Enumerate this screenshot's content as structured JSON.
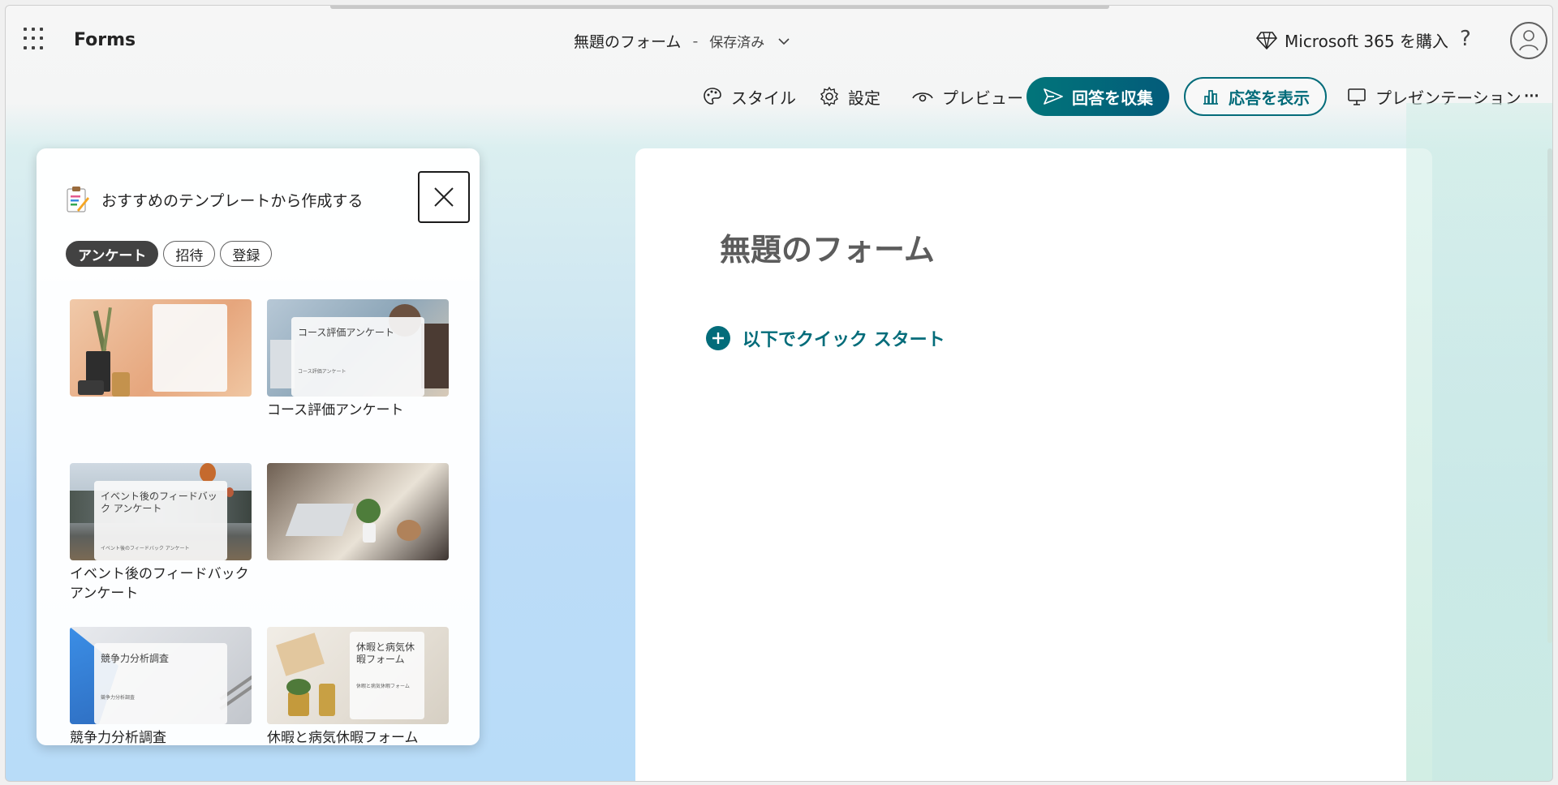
{
  "header": {
    "app_name": "Forms",
    "form_title": "無題のフォーム",
    "separator": "-",
    "save_status": "保存済み",
    "buy_label": "Microsoft 365 を購入",
    "help_label": "?"
  },
  "toolbar": {
    "style_label": "スタイル",
    "settings_label": "設定",
    "preview_label": "プレビュー",
    "collect_label": "回答を収集",
    "responses_label": "応答を表示",
    "present_label": "プレゼンテーション",
    "more_label": "···"
  },
  "templates": {
    "title": "おすすめのテンプレートから作成する",
    "chips": [
      "アンケート",
      "招待",
      "登録"
    ],
    "cards": [
      {
        "label": "",
        "thumb_title": "",
        "thumb_sub": ""
      },
      {
        "label": "コース評価アンケート",
        "thumb_title": "コース評価アンケート",
        "thumb_sub": "コース評価アンケート"
      },
      {
        "label": "イベント後のフィードバック アンケート",
        "thumb_title": "イベント後のフィードバック アンケート",
        "thumb_sub": "イベント後のフィードバック アンケート"
      },
      {
        "label": "",
        "thumb_title": "",
        "thumb_sub": ""
      },
      {
        "label": "競争力分析調査",
        "thumb_title": "競争力分析調査",
        "thumb_sub": "競争力分析調査"
      },
      {
        "label": "休暇と病気休暇フォーム",
        "thumb_title": "休暇と病気休暇フォーム",
        "thumb_sub": "休暇と病気休暇フォーム"
      }
    ]
  },
  "form": {
    "title": "無題のフォーム",
    "quick_start_label": "以下でクイック スタート"
  },
  "colors": {
    "accent": "#036c7a",
    "collect_bg": "#02757a",
    "chip_active": "#424242"
  }
}
